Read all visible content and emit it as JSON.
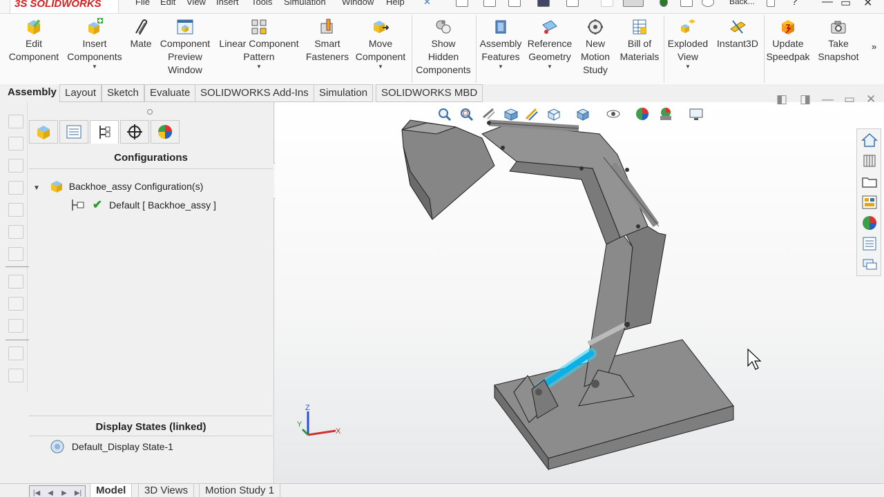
{
  "app": {
    "brand": "SOLIDWORKS",
    "brand_prefix": "3S",
    "document": "Back...",
    "accent": "#d62020"
  },
  "menu": [
    "File",
    "Edit",
    "View",
    "Insert",
    "Tools",
    "Simulation",
    "Window",
    "Help"
  ],
  "ribbon": {
    "commands": [
      {
        "label": "Edit\nComponent",
        "icon": "edit-component-icon",
        "dropdown": false
      },
      {
        "label": "Insert\nComponents",
        "icon": "insert-components-icon",
        "dropdown": true
      },
      {
        "label": "Mate",
        "icon": "mate-icon",
        "dropdown": false
      },
      {
        "label": "Component\nPreview\nWindow",
        "icon": "component-preview-icon",
        "dropdown": false
      },
      {
        "label": "Linear Component\nPattern",
        "icon": "linear-pattern-icon",
        "dropdown": true
      },
      {
        "label": "Smart\nFasteners",
        "icon": "smart-fasteners-icon",
        "dropdown": false
      },
      {
        "label": "Move\nComponent",
        "icon": "move-component-icon",
        "dropdown": true
      },
      {
        "label": "Show\nHidden\nComponents",
        "icon": "show-hidden-icon",
        "dropdown": false
      },
      {
        "label": "Assembly\nFeatures",
        "icon": "assembly-features-icon",
        "dropdown": true
      },
      {
        "label": "Reference\nGeometry",
        "icon": "reference-geometry-icon",
        "dropdown": true
      },
      {
        "label": "New\nMotion\nStudy",
        "icon": "motion-study-icon",
        "dropdown": false
      },
      {
        "label": "Bill of\nMaterials",
        "icon": "bill-of-materials-icon",
        "dropdown": false
      },
      {
        "label": "Exploded\nView",
        "icon": "exploded-view-icon",
        "dropdown": true
      },
      {
        "label": "Instant3D",
        "icon": "instant3d-icon",
        "dropdown": false
      },
      {
        "label": "Update\nSpeedpak",
        "icon": "speedpak-icon",
        "dropdown": false
      },
      {
        "label": "Take\nSnapshot",
        "icon": "snapshot-icon",
        "dropdown": false
      }
    ],
    "more": "»"
  },
  "tabs": [
    "Assembly",
    "Layout",
    "Sketch",
    "Evaluate",
    "SOLIDWORKS Add-Ins",
    "Simulation",
    "SOLIDWORKS MBD"
  ],
  "configuration_manager": {
    "title": "Configurations",
    "root": "Backhoe_assy Configuration(s)",
    "active_config": "Default [ Backhoe_assy ]",
    "display_states_title": "Display States (linked)",
    "display_state": "Default_Display State-1"
  },
  "bottom_tabs": [
    "Model",
    "3D Views",
    "Motion Study 1"
  ],
  "triad": {
    "x": "X",
    "y": "Y",
    "z": "Z"
  }
}
